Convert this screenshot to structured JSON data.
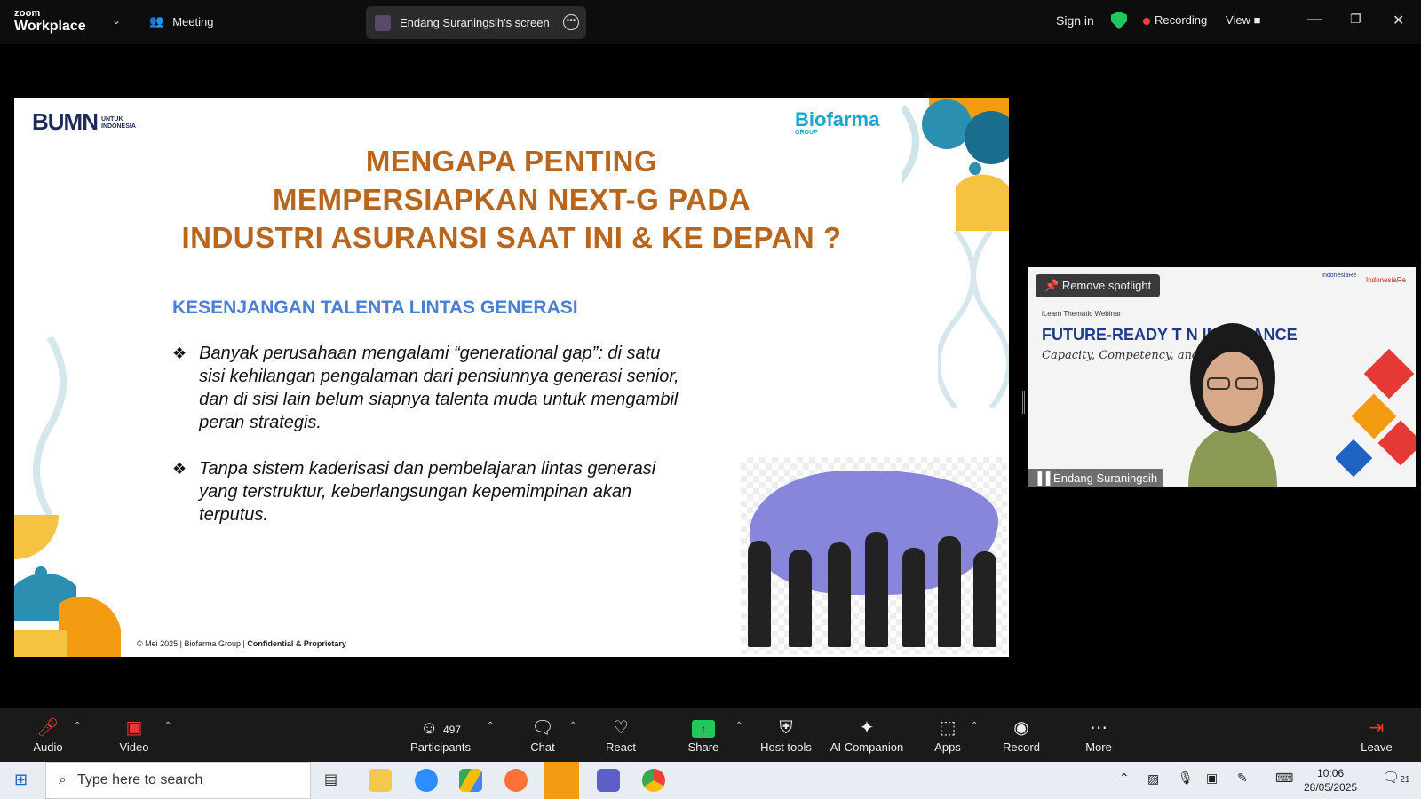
{
  "topbar": {
    "logo_line1": "zoom",
    "logo_line2": "Workplace",
    "meeting_label": "Meeting",
    "screen_share_label": "Endang Suraningsih's screen",
    "sign_in": "Sign in",
    "recording": "Recording",
    "view": "View",
    "recording_color": "#ff4040",
    "shield_color": "#22c55e"
  },
  "slide": {
    "bumn_logo": "BUMN",
    "bumn_tag": "UNTUK INDONESIA",
    "biofarma_logo": "Biofarma",
    "biofarma_tag": "GROUP",
    "title_line1": "MENGAPA PENTING",
    "title_line2": "MEMPERSIAPKAN NEXT-G  PADA",
    "title_line3": "INDUSTRI ASURANSI SAAT INI & KE DEPAN ?",
    "subtitle": "KESENJANGAN TALENTA LINTAS GENERASI",
    "bullets": [
      "Banyak perusahaan mengalami “generational gap”: di satu sisi kehilangan pengalaman dari pensiunnya generasi senior, dan di sisi lain belum siapnya talenta muda untuk mengambil peran strategis.",
      "Tanpa sistem kaderisasi dan pembelajaran lintas generasi yang terstruktur, keberlangsungan kepemimpinan akan terputus."
    ],
    "footer_plain": "© Mei 2025 | Biofarma Group | ",
    "footer_bold": "Confidential & Proprietary",
    "title_color": "#b8651d",
    "subtitle_color": "#4a7fd6"
  },
  "video": {
    "remove_spotlight": "Remove spotlight",
    "webinar_small": "iLearn Thematic Webinar",
    "webinar_title": "FUTURE-READY T        N INSURANCE",
    "webinar_caption": "Capacity, Competency, and Cultu",
    "participant_name": "Endang Suraningsih",
    "brand_left": "IndonesiaRe",
    "brand_right": "IndonesiaRe"
  },
  "toolbar": {
    "audio": "Audio",
    "video": "Video",
    "participants": "Participants",
    "participants_count": "497",
    "chat": "Chat",
    "react": "React",
    "share": "Share",
    "host_tools": "Host tools",
    "ai_companion": "AI Companion",
    "apps": "Apps",
    "record": "Record",
    "more": "More",
    "leave": "Leave",
    "share_color": "#22c55e"
  },
  "taskbar": {
    "search_placeholder": "Type here to search",
    "time": "10:06",
    "date": "28/05/2025",
    "notifications": "21"
  }
}
